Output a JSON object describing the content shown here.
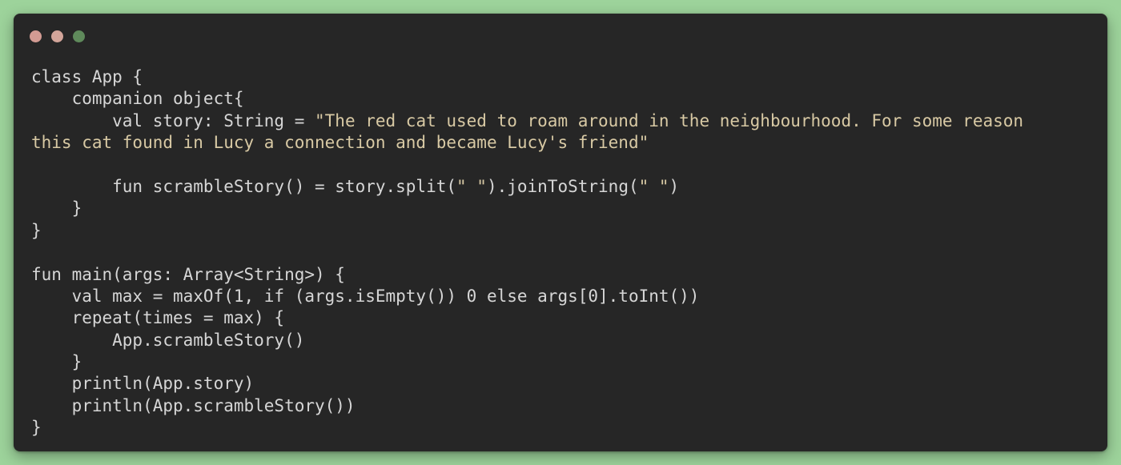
{
  "colors": {
    "background": "#9dd39b",
    "window": "#262626",
    "dot_close": "#d39b93",
    "dot_minimize": "#d3a59a",
    "dot_zoom": "#5f8a5b",
    "code_default": "#d6d6d6",
    "string": "#d8c9a4",
    "keyword": "#c9c9c9"
  },
  "window_controls": [
    {
      "name": "close-dot",
      "color": "#d39b93"
    },
    {
      "name": "minimize-dot",
      "color": "#d3a59a"
    },
    {
      "name": "zoom-dot",
      "color": "#5f8a5b"
    }
  ],
  "code": {
    "language": "kotlin",
    "lines": [
      [
        {
          "t": "class App {",
          "k": "plain"
        }
      ],
      [
        {
          "t": "    companion object{",
          "k": "plain"
        }
      ],
      [
        {
          "t": "        val story: String = ",
          "k": "plain"
        },
        {
          "t": "\"The red cat used to roam around in the neighbourhood. For some reason",
          "k": "string"
        }
      ],
      [
        {
          "t": "this cat found in Lucy a connection and became Lucy's friend\"",
          "k": "string"
        }
      ],
      [],
      [
        {
          "t": "        fun scrambleStory() = story.split(",
          "k": "plain"
        },
        {
          "t": "\" \"",
          "k": "string"
        },
        {
          "t": ").joinToString(",
          "k": "plain"
        },
        {
          "t": "\" \"",
          "k": "string"
        },
        {
          "t": ")",
          "k": "plain"
        }
      ],
      [
        {
          "t": "    }",
          "k": "plain"
        }
      ],
      [
        {
          "t": "}",
          "k": "plain"
        }
      ],
      [],
      [
        {
          "t": "fun main(args: Array<String>) {",
          "k": "plain"
        }
      ],
      [
        {
          "t": "    val max = maxOf(1, if (args.isEmpty()) 0 else args[0].toInt())",
          "k": "plain"
        }
      ],
      [
        {
          "t": "    repeat(times = max) {",
          "k": "plain"
        }
      ],
      [
        {
          "t": "        App.scrambleStory()",
          "k": "plain"
        }
      ],
      [
        {
          "t": "    }",
          "k": "plain"
        }
      ],
      [
        {
          "t": "    println(App.story)",
          "k": "plain"
        }
      ],
      [
        {
          "t": "    println(App.scrambleStory())",
          "k": "plain"
        }
      ],
      [
        {
          "t": "}",
          "k": "plain"
        }
      ]
    ]
  }
}
